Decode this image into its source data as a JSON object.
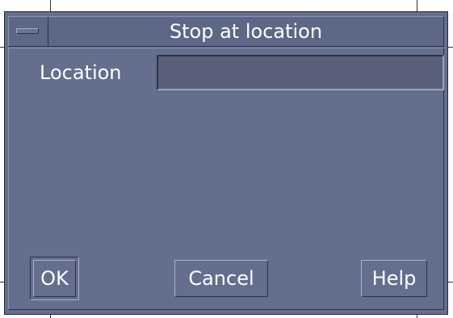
{
  "window": {
    "title": "Stop at location",
    "menu_icon": "window-menu-icon"
  },
  "form": {
    "location_label": "Location",
    "location_value": "",
    "location_placeholder": ""
  },
  "buttons": {
    "ok_label": "OK",
    "cancel_label": "Cancel",
    "help_label": "Help"
  },
  "colors": {
    "background": "#646e8e",
    "title_bar": "#5d6787",
    "input_background": "#595f78",
    "text": "#ffffff"
  }
}
